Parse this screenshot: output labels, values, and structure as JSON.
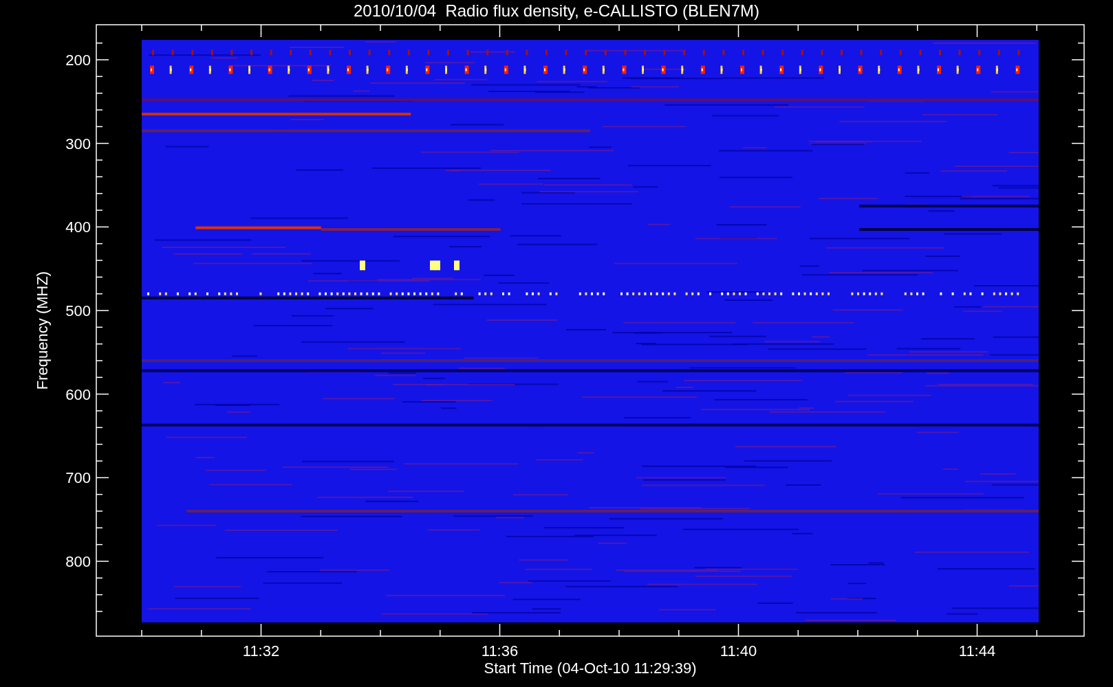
{
  "title": "2010/10/04  Radio flux density, e-CALLISTO (BLEN7M)",
  "y_axis": {
    "label": "Frequency (MHZ)",
    "ticks": [
      "200",
      "300",
      "400",
      "500",
      "600",
      "700",
      "800"
    ]
  },
  "x_axis": {
    "label": "Start Time (04-Oct-10 11:29:39)",
    "ticks": [
      "11:32",
      "11:36",
      "11:40",
      "11:44"
    ]
  }
}
